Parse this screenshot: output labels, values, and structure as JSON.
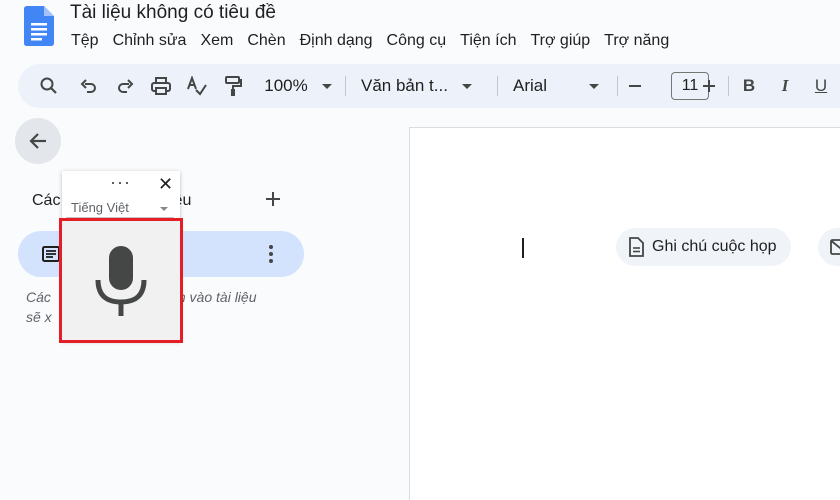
{
  "document": {
    "title": "Tài liệu không có tiêu đề"
  },
  "menu": [
    "Tệp",
    "Chỉnh sửa",
    "Xem",
    "Chèn",
    "Định dạng",
    "Công cụ",
    "Tiện ích",
    "Trợ giúp",
    "Trợ năng"
  ],
  "toolbar": {
    "zoom": "100%",
    "style": "Văn bản t...",
    "font": "Arial",
    "font_size": "11",
    "bold": "B",
    "italic": "I",
    "underline": "U"
  },
  "sidebar": {
    "heading_visible": "Các",
    "heading_tail": "iêu",
    "hint_line_1_start": "Các",
    "hint_line_1_end": "m vào tài liệu",
    "hint_line_2": "sẽ x"
  },
  "voice_typing": {
    "language": "Tiếng Việt",
    "dots": "···",
    "close": "✕"
  },
  "page": {
    "chip_label": "Ghi chú cuộc họp"
  },
  "colors": {
    "accent_blue": "#1a73e8",
    "toolbar_bg": "#edf2fa",
    "tab_selected_bg": "#d3e3fd",
    "highlight_red": "#e41e26"
  },
  "icons": {
    "logo": "google-docs-icon",
    "search": "search-icon",
    "undo": "undo-icon",
    "redo": "redo-icon",
    "print": "print-icon",
    "spellcheck": "spellcheck-icon",
    "paint_format": "paint-format-icon",
    "back": "arrow-back-icon",
    "add": "plus-icon",
    "document_tab": "document-tab-icon",
    "more": "more-vert-icon",
    "microphone": "microphone-icon",
    "chip_doc": "document-chip-icon",
    "mail": "mail-icon"
  }
}
